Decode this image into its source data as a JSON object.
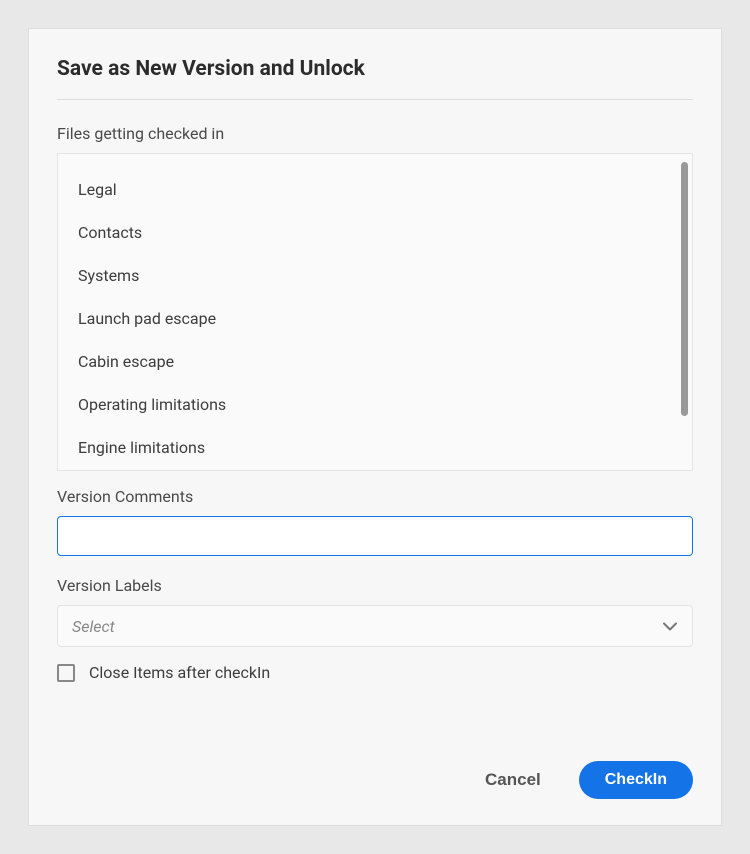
{
  "dialog": {
    "title": "Save as New Version and Unlock"
  },
  "files": {
    "label": "Files getting checked in",
    "items": [
      "Legal",
      "Contacts",
      "Systems",
      "Launch pad escape",
      "Cabin escape",
      "Operating limitations",
      "Engine limitations"
    ]
  },
  "versionComments": {
    "label": "Version Comments",
    "value": ""
  },
  "versionLabels": {
    "label": "Version Labels",
    "placeholder": "Select"
  },
  "closeItems": {
    "label": "Close Items after checkIn",
    "checked": false
  },
  "buttons": {
    "cancel": "Cancel",
    "checkin": "CheckIn"
  }
}
